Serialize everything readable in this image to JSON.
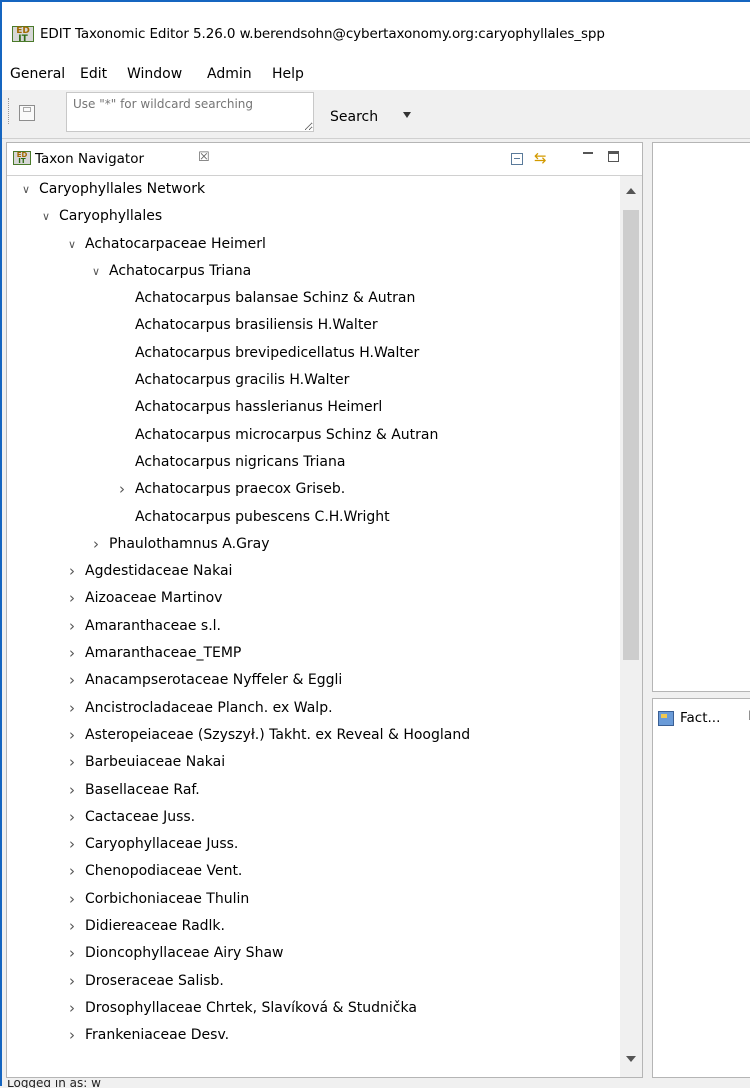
{
  "window": {
    "title": "EDIT Taxonomic Editor 5.26.0 w.berendsohn@cybertaxonomy.org:caryophyllales_spp"
  },
  "menu": [
    "General",
    "Edit",
    "Window",
    "Admin",
    "Help"
  ],
  "toolbar": {
    "search_placeholder": "Use \"*\" for wildcard searching",
    "search_label": "Search"
  },
  "navigator": {
    "title": "Taxon Navigator",
    "close": "☒",
    "tree": [
      {
        "label": "Caryophyllales Network",
        "depth": 0,
        "state": "expanded"
      },
      {
        "label": "Caryophyllales",
        "depth": 1,
        "state": "expanded"
      },
      {
        "label": "Achatocarpaceae Heimerl",
        "depth": 2,
        "state": "expanded"
      },
      {
        "label": "Achatocarpus Triana",
        "depth": 3,
        "state": "expanded"
      },
      {
        "label": "Achatocarpus balansae Schinz & Autran",
        "depth": 4,
        "state": "leaf"
      },
      {
        "label": "Achatocarpus brasiliensis H.Walter",
        "depth": 4,
        "state": "leaf"
      },
      {
        "label": "Achatocarpus brevipedicellatus H.Walter",
        "depth": 4,
        "state": "leaf"
      },
      {
        "label": "Achatocarpus gracilis H.Walter",
        "depth": 4,
        "state": "leaf"
      },
      {
        "label": "Achatocarpus hasslerianus Heimerl",
        "depth": 4,
        "state": "leaf"
      },
      {
        "label": "Achatocarpus microcarpus Schinz & Autran",
        "depth": 4,
        "state": "leaf"
      },
      {
        "label": "Achatocarpus nigricans Triana",
        "depth": 4,
        "state": "leaf"
      },
      {
        "label": "Achatocarpus praecox Griseb.",
        "depth": 4,
        "state": "collapsed"
      },
      {
        "label": "Achatocarpus pubescens C.H.Wright",
        "depth": 4,
        "state": "leaf"
      },
      {
        "label": "Phaulothamnus A.Gray",
        "depth": 3,
        "state": "collapsed"
      },
      {
        "label": "Agdestidaceae Nakai",
        "depth": 2,
        "state": "collapsed"
      },
      {
        "label": "Aizoaceae Martinov",
        "depth": 2,
        "state": "collapsed"
      },
      {
        "label": "Amaranthaceae s.l.",
        "depth": 2,
        "state": "collapsed"
      },
      {
        "label": "Amaranthaceae_TEMP",
        "depth": 2,
        "state": "collapsed"
      },
      {
        "label": "Anacampserotaceae Nyffeler & Eggli",
        "depth": 2,
        "state": "collapsed"
      },
      {
        "label": "Ancistrocladaceae Planch. ex Walp.",
        "depth": 2,
        "state": "collapsed"
      },
      {
        "label": "Asteropeiaceae (Szyszył.) Takht. ex Reveal & Hoogland",
        "depth": 2,
        "state": "collapsed"
      },
      {
        "label": "Barbeuiaceae Nakai",
        "depth": 2,
        "state": "collapsed"
      },
      {
        "label": "Basellaceae Raf.",
        "depth": 2,
        "state": "collapsed"
      },
      {
        "label": "Cactaceae Juss.",
        "depth": 2,
        "state": "collapsed"
      },
      {
        "label": "Caryophyllaceae Juss.",
        "depth": 2,
        "state": "collapsed"
      },
      {
        "label": "Chenopodiaceae Vent.",
        "depth": 2,
        "state": "collapsed"
      },
      {
        "label": "Corbichoniaceae Thulin",
        "depth": 2,
        "state": "collapsed"
      },
      {
        "label": "Didiereaceae Radlk.",
        "depth": 2,
        "state": "collapsed"
      },
      {
        "label": "Dioncophyllaceae Airy Shaw",
        "depth": 2,
        "state": "collapsed"
      },
      {
        "label": "Droseraceae Salisb.",
        "depth": 2,
        "state": "collapsed"
      },
      {
        "label": "Drosophyllaceae Chrtek, Slavíková & Studnička",
        "depth": 2,
        "state": "collapsed"
      },
      {
        "label": "Frankeniaceae Desv.",
        "depth": 2,
        "state": "collapsed"
      }
    ]
  },
  "fact_panel": {
    "title": "Fact...",
    "close": "☒"
  },
  "status": {
    "text": "Logged in as: w"
  },
  "colors": {
    "window_border": "#1565c0",
    "panel_border": "#b5b5b5",
    "chrome": "#f0f0f0"
  }
}
